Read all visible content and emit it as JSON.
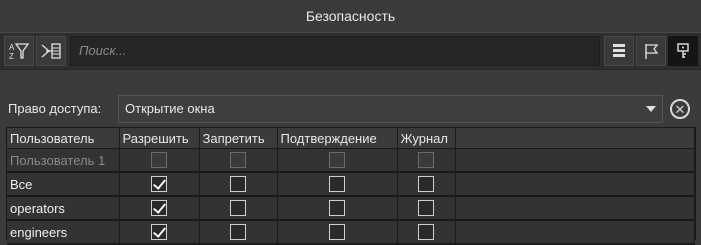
{
  "window": {
    "title": "Безопасность"
  },
  "toolbar": {
    "search_placeholder": "Поиск...",
    "buttons": [
      "sort-filter-icon",
      "filter-add-icon",
      "list-icon",
      "flag-icon",
      "key-icon"
    ]
  },
  "access": {
    "label": "Право доступа:",
    "selected": "Открытие окна"
  },
  "table": {
    "headers": [
      "Пользователь",
      "Разрешить",
      "Запретить",
      "Подтверждение",
      "Журнал"
    ],
    "rows": [
      {
        "user": "Пользователь 1",
        "allow": false,
        "deny": false,
        "confirm": false,
        "log": false,
        "disabled": true
      },
      {
        "user": "Все",
        "allow": true,
        "deny": false,
        "confirm": false,
        "log": false,
        "disabled": false
      },
      {
        "user": "operators",
        "allow": true,
        "deny": false,
        "confirm": false,
        "log": false,
        "disabled": false
      },
      {
        "user": "engineers",
        "allow": true,
        "deny": false,
        "confirm": false,
        "log": false,
        "disabled": false
      }
    ]
  },
  "colors": {
    "background": "#3b3b3b",
    "toolbar": "#2e2e2e",
    "active_button": "#151515"
  }
}
